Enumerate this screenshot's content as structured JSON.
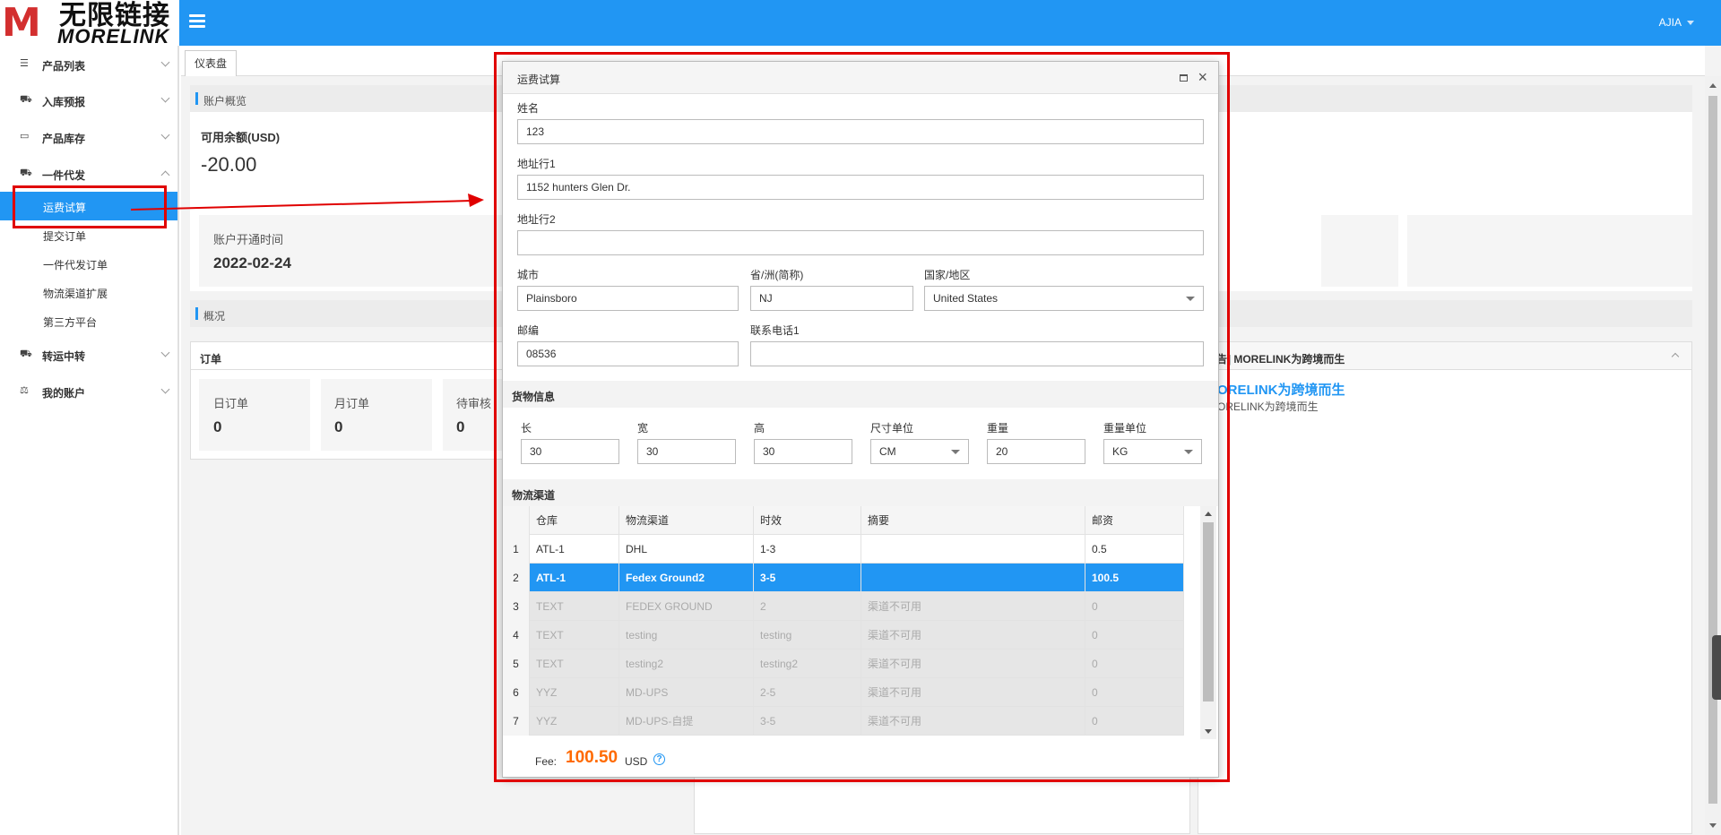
{
  "header": {
    "logo_mark": "M",
    "logo_cn": "无限链接",
    "logo_en": "MORELINK",
    "user": "AJIA"
  },
  "sidebar": {
    "items": [
      {
        "label": "产品列表",
        "icon": "list-icon"
      },
      {
        "label": "入库预报",
        "icon": "truck-icon"
      },
      {
        "label": "产品库存",
        "icon": "inbox-icon"
      },
      {
        "label": "一件代发",
        "icon": "truck-icon"
      },
      {
        "label": "转运中转",
        "icon": "truck-icon"
      },
      {
        "label": "我的账户",
        "icon": "balance-icon"
      }
    ],
    "subitems": [
      "运费试算",
      "提交订单",
      "一件代发订单",
      "物流渠道扩展",
      "第三方平台"
    ]
  },
  "tabs": [
    "仪表盘"
  ],
  "dashboard": {
    "account_overview": "账户概览",
    "balance_label": "可用余额(USD)",
    "balance_value": "-20.00",
    "open_date_label": "账户开通时间",
    "open_date_value": "2022-02-24",
    "overview": "概况",
    "orders_title": "订单",
    "order_cards": [
      {
        "label": "日订单",
        "value": "0"
      },
      {
        "label": "月订单",
        "value": "0"
      },
      {
        "label": "待审核",
        "value": "0"
      }
    ],
    "notice_title": "告] MORELINK为跨境而生",
    "notice_headline": "ORELINK为跨境而生",
    "notice_body": "ORELINK为跨境而生"
  },
  "dialog": {
    "title": "运费试算",
    "fields": {
      "name_label": "姓名",
      "name_value": "123",
      "addr1_label": "地址行1",
      "addr1_value": "1152 hunters Glen Dr.",
      "addr2_label": "地址行2",
      "addr2_value": "",
      "city_label": "城市",
      "city_value": "Plainsboro",
      "state_label": "省/洲(简称)",
      "state_value": "NJ",
      "country_label": "国家/地区",
      "country_value": "United States",
      "zip_label": "邮编",
      "zip_value": "08536",
      "phone_label": "联系电话1",
      "phone_value": ""
    },
    "cargo_title": "货物信息",
    "cargo": {
      "length_label": "长",
      "length_value": "30",
      "width_label": "宽",
      "width_value": "30",
      "height_label": "高",
      "height_value": "30",
      "unit_label": "尺寸单位",
      "unit_value": "CM",
      "weight_label": "重量",
      "weight_value": "20",
      "weight_unit_label": "重量单位",
      "weight_unit_value": "KG"
    },
    "channel_title": "物流渠道",
    "table": {
      "headers": [
        "仓库",
        "物流渠道",
        "时效",
        "摘要",
        "邮资"
      ],
      "rows": [
        {
          "n": "1",
          "cells": [
            "ATL-1",
            "DHL",
            "1-3",
            "",
            "0.5"
          ],
          "state": "normal"
        },
        {
          "n": "2",
          "cells": [
            "ATL-1",
            "Fedex Ground2",
            "3-5",
            "",
            "100.5"
          ],
          "state": "selected"
        },
        {
          "n": "3",
          "cells": [
            "TEXT",
            "FEDEX GROUND",
            "2",
            "渠道不可用",
            "0"
          ],
          "state": "disabled"
        },
        {
          "n": "4",
          "cells": [
            "TEXT",
            "testing",
            "testing",
            "渠道不可用",
            "0"
          ],
          "state": "disabled"
        },
        {
          "n": "5",
          "cells": [
            "TEXT",
            "testing2",
            "testing2",
            "渠道不可用",
            "0"
          ],
          "state": "disabled"
        },
        {
          "n": "6",
          "cells": [
            "YYZ",
            "MD-UPS",
            "2-5",
            "渠道不可用",
            "0"
          ],
          "state": "disabled"
        },
        {
          "n": "7",
          "cells": [
            "YYZ",
            "MD-UPS-自提",
            "3-5",
            "渠道不可用",
            "0"
          ],
          "state": "disabled"
        }
      ]
    },
    "fee_label": "Fee:",
    "fee_value": "100.50",
    "fee_unit": "USD"
  },
  "colors": {
    "primary": "#2196f3",
    "annotation": "#e00000",
    "fee": "#ff6a00"
  }
}
